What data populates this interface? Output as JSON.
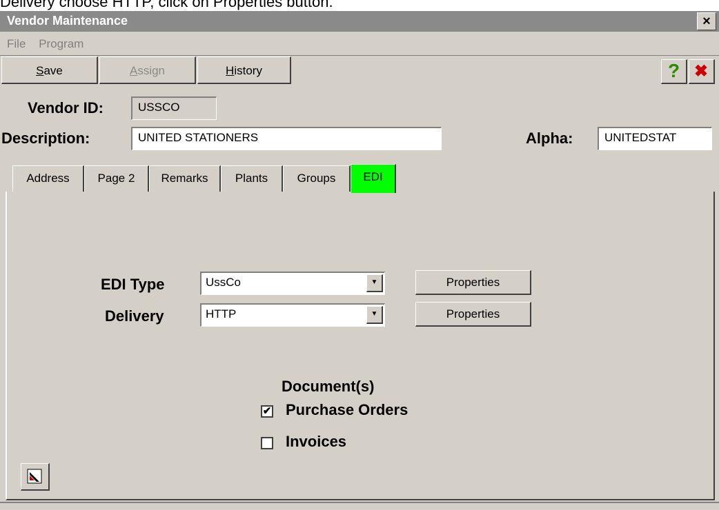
{
  "caption": "Delivery choose HTTP, click on Properties button.",
  "window": {
    "title": "Vendor Maintenance",
    "close_symbol": "×"
  },
  "menu": [
    "File",
    "Program"
  ],
  "toolbar": {
    "save": {
      "prefix": "",
      "ul": "S",
      "rest": "ave"
    },
    "assign": {
      "prefix": "",
      "ul": "A",
      "rest": "ssign"
    },
    "history": {
      "prefix": "",
      "ul": "H",
      "rest": "istory"
    },
    "help_symbol": "?",
    "exit_symbol": "✖"
  },
  "header": {
    "vendor_id_label": "Vendor ID:",
    "vendor_id_value": "USSCO",
    "description_label": "Description:",
    "description_value": "UNITED STATIONERS",
    "alpha_label": "Alpha:",
    "alpha_value": "UNITEDSTAT"
  },
  "tabs": [
    "Address",
    "Page 2",
    "Remarks",
    "Plants",
    "Groups",
    "EDI"
  ],
  "active_tab": "EDI",
  "edi": {
    "type_label": "EDI Type",
    "type_value": "UssCo",
    "delivery_label": "Delivery",
    "delivery_value": "HTTP",
    "properties_label": "Properties",
    "documents_label": "Document(s)",
    "purchase_orders_label": "Purchase Orders",
    "purchase_orders_checked": "✔",
    "invoices_label": "Invoices",
    "invoices_checked": ""
  },
  "colors": {
    "active_tab": "#00ff00",
    "exit": "#cc0000",
    "help": "#2e8b00"
  }
}
